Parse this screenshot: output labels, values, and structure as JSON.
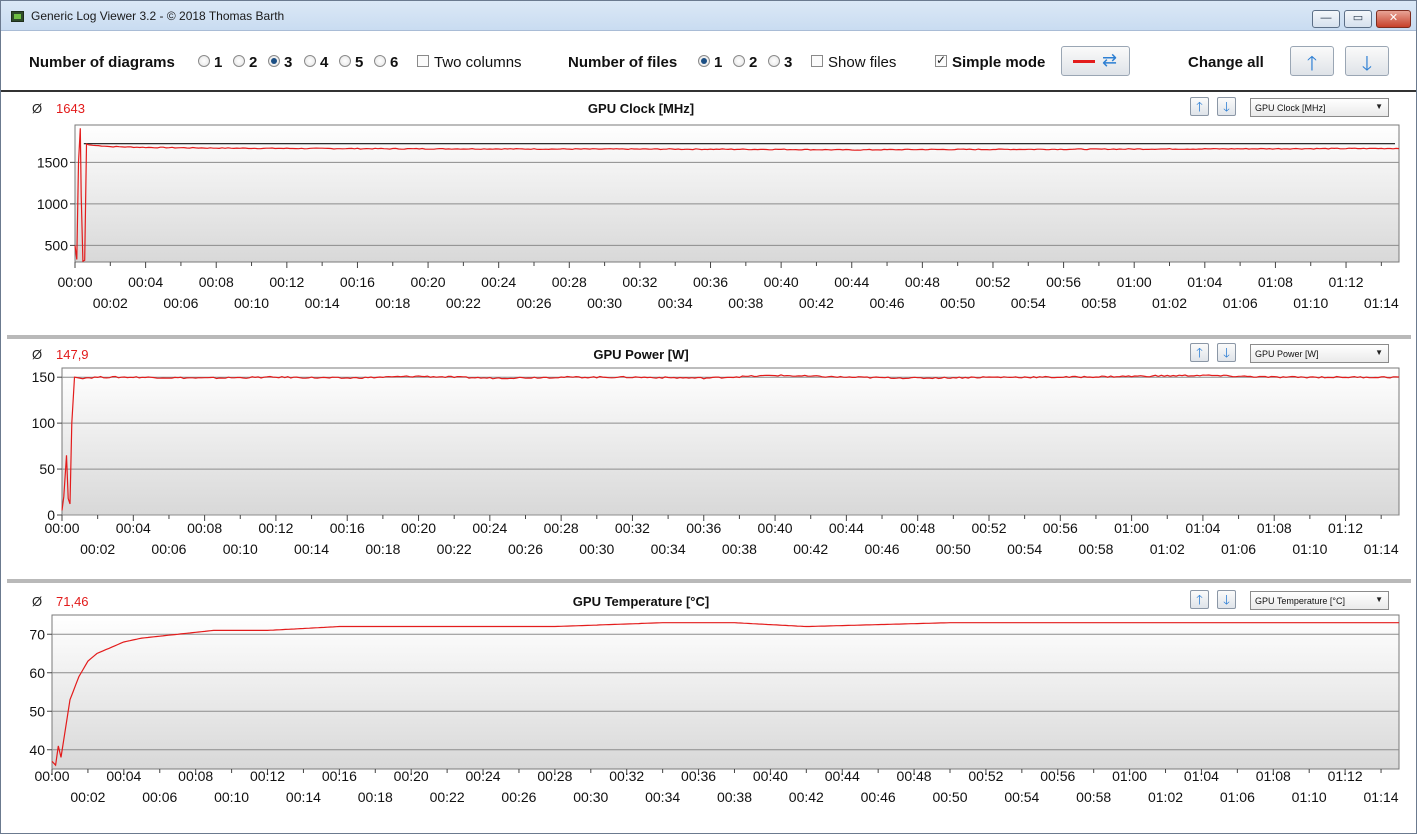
{
  "window": {
    "title": "Generic Log Viewer 3.2 - © 2018 Thomas Barth",
    "min_glyph": "—",
    "max_glyph": "▭",
    "close_glyph": "✕"
  },
  "toolbar": {
    "num_diagrams_label": "Number of diagrams",
    "diagram_options": [
      "1",
      "2",
      "3",
      "4",
      "5",
      "6"
    ],
    "diagram_selected": "3",
    "two_columns_label": "Two columns",
    "two_columns_checked": false,
    "num_files_label": "Number of files",
    "file_options": [
      "1",
      "2",
      "3"
    ],
    "file_selected": "1",
    "show_files_label": "Show files",
    "show_files_checked": false,
    "simple_mode_label": "Simple mode",
    "simple_mode_checked": true,
    "change_all_label": "Change all",
    "line_color": "#e31c1c",
    "icons": {
      "color_button": "red-line-icon",
      "refresh": "refresh-icon",
      "up": "arrow-up-icon",
      "down": "arrow-down-icon"
    }
  },
  "panels": [
    {
      "avg_symbol": "Ø",
      "avg_value": "1643",
      "title": "GPU Clock [MHz]",
      "dropdown": "GPU Clock [MHz]"
    },
    {
      "avg_symbol": "Ø",
      "avg_value": "147,9",
      "title": "GPU Power [W]",
      "dropdown": "GPU Power [W]"
    },
    {
      "avg_symbol": "Ø",
      "avg_value": "71,46",
      "title": "GPU Temperature [°C]",
      "dropdown": "GPU Temperature [°C]"
    }
  ],
  "chart_data": [
    {
      "type": "line",
      "title": "GPU Clock [MHz]",
      "series_color": "#e31c1c",
      "reference_line": 1725,
      "ylim": [
        300,
        1950
      ],
      "yticks": [
        500,
        1000,
        1500
      ],
      "xlim_min": [
        0,
        75
      ],
      "xticks_top": [
        "00:00",
        "00:04",
        "00:08",
        "00:12",
        "00:16",
        "00:20",
        "00:24",
        "00:28",
        "00:32",
        "00:36",
        "00:40",
        "00:44",
        "00:48",
        "00:52",
        "00:56",
        "01:00",
        "01:04",
        "01:08",
        "01:12"
      ],
      "xticks_bottom": [
        "00:02",
        "00:06",
        "00:10",
        "00:14",
        "00:18",
        "00:22",
        "00:26",
        "00:30",
        "00:34",
        "00:38",
        "00:42",
        "00:46",
        "00:50",
        "00:54",
        "00:58",
        "01:02",
        "01:06",
        "01:10",
        "01:14"
      ],
      "x": [
        0,
        0.1,
        0.2,
        0.3,
        0.35,
        0.45,
        0.55,
        0.65,
        0.8,
        1,
        1.5,
        2,
        4,
        8,
        12,
        16,
        20,
        24,
        28,
        32,
        36,
        40,
        44,
        48,
        52,
        56,
        60,
        64,
        68,
        72,
        75
      ],
      "y": [
        500,
        330,
        1500,
        1910,
        1100,
        310,
        320,
        1720,
        1710,
        1705,
        1700,
        1690,
        1680,
        1672,
        1668,
        1665,
        1663,
        1662,
        1660,
        1660,
        1658,
        1656,
        1650,
        1655,
        1656,
        1658,
        1660,
        1662,
        1664,
        1666,
        1668
      ]
    },
    {
      "type": "line",
      "title": "GPU Power [W]",
      "series_color": "#e31c1c",
      "ylim": [
        0,
        160
      ],
      "yticks": [
        0,
        50,
        100,
        150
      ],
      "xlim_min": [
        0,
        75
      ],
      "xticks_top": [
        "00:00",
        "00:04",
        "00:08",
        "00:12",
        "00:16",
        "00:20",
        "00:24",
        "00:28",
        "00:32",
        "00:36",
        "00:40",
        "00:44",
        "00:48",
        "00:52",
        "00:56",
        "01:00",
        "01:04",
        "01:08",
        "01:12"
      ],
      "xticks_bottom": [
        "00:02",
        "00:06",
        "00:10",
        "00:14",
        "00:18",
        "00:22",
        "00:26",
        "00:30",
        "00:34",
        "00:38",
        "00:42",
        "00:46",
        "00:50",
        "00:54",
        "00:58",
        "01:02",
        "01:06",
        "01:10",
        "01:14"
      ],
      "x": [
        0,
        0.1,
        0.25,
        0.35,
        0.45,
        0.55,
        0.7,
        1,
        2,
        4,
        8,
        12,
        16,
        20,
        24,
        28,
        32,
        36,
        40,
        44,
        48,
        52,
        56,
        60,
        64,
        68,
        72,
        75
      ],
      "y": [
        5,
        20,
        65,
        18,
        12,
        100,
        150,
        149,
        150,
        150,
        149,
        150,
        149,
        151,
        149,
        150,
        150,
        149,
        152,
        150,
        149,
        150,
        150,
        151,
        152,
        150,
        150,
        150
      ]
    },
    {
      "type": "line",
      "title": "GPU Temperature [°C]",
      "series_color": "#e31c1c",
      "ylim": [
        35,
        75
      ],
      "yticks": [
        40,
        50,
        60,
        70
      ],
      "xlim_min": [
        0,
        75
      ],
      "xticks_top": [
        "00:00",
        "00:04",
        "00:08",
        "00:12",
        "00:16",
        "00:20",
        "00:24",
        "00:28",
        "00:32",
        "00:36",
        "00:40",
        "00:44",
        "00:48",
        "00:52",
        "00:56",
        "01:00",
        "01:04",
        "01:08",
        "01:12"
      ],
      "xticks_bottom": [
        "00:02",
        "00:06",
        "00:10",
        "00:14",
        "00:18",
        "00:22",
        "00:26",
        "00:30",
        "00:34",
        "00:38",
        "00:42",
        "00:46",
        "00:50",
        "00:54",
        "00:58",
        "01:02",
        "01:06",
        "01:10",
        "01:14"
      ],
      "x": [
        0,
        0.2,
        0.35,
        0.5,
        0.7,
        1,
        1.5,
        2,
        2.5,
        3,
        4,
        5,
        6,
        7,
        8,
        9,
        10,
        12,
        14,
        16,
        20,
        24,
        28,
        31,
        34,
        38,
        42,
        46,
        50,
        54,
        58,
        62,
        66,
        70,
        75
      ],
      "y": [
        37,
        36,
        41,
        38,
        44,
        53,
        59,
        63,
        65,
        66,
        68,
        69,
        69.5,
        70,
        70.5,
        71,
        71,
        71,
        71.5,
        72,
        72,
        72,
        72,
        72.5,
        73,
        73,
        72,
        72.5,
        73,
        73,
        73,
        73,
        73,
        73,
        73
      ]
    }
  ]
}
